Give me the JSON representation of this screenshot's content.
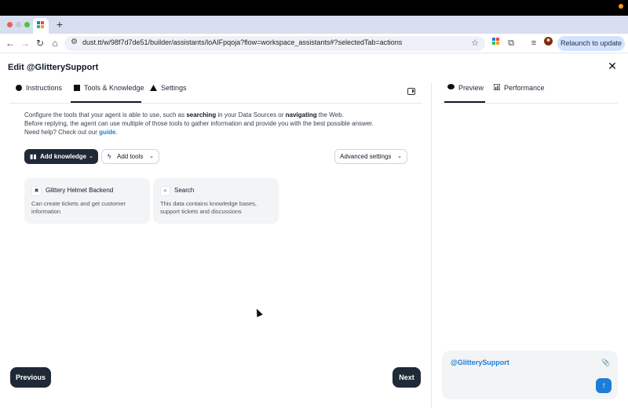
{
  "browser": {
    "url": "dust.tt/w/98f7d7de51/builder/assistants/loAIFpqoja?flow=workspace_assistants#?selectedTab=actions",
    "relaunch_label": "Relaunch to update",
    "new_tab_glyph": "+",
    "icons": [
      "back-icon",
      "forward-icon",
      "reload-icon",
      "home-icon",
      "site-settings-icon",
      "bookmark-star-icon",
      "extensions-icon",
      "media-icon",
      "profile-icon",
      "menu-icon"
    ]
  },
  "header": {
    "title": "Edit @GlitterySupport",
    "close_glyph": "✕"
  },
  "tabs": [
    {
      "label": "Instructions",
      "icon": "circle-icon",
      "active": false
    },
    {
      "label": "Tools & Knowledge",
      "icon": "square-icon",
      "active": true
    },
    {
      "label": "Settings",
      "icon": "triangle-icon",
      "active": false
    }
  ],
  "description": {
    "line1_prefix": "Configure the tools that your agent is able to use, such as ",
    "line1_bold1": "searching",
    "line1_mid": " in your Data Sources or ",
    "line1_bold2": "navigating",
    "line1_suffix": " the Web.",
    "line2": "Before replying, the agent can use multiple of those tools to gather information and provide you with the best possible answer.",
    "line3_prefix": "Need help? Check out our ",
    "line3_link": "guide",
    "line3_suffix": "."
  },
  "buttons": {
    "add_knowledge": "Add knowledge",
    "add_tools": "Add tools",
    "advanced_settings": "Advanced settings",
    "previous": "Previous",
    "next": "Next"
  },
  "cards": [
    {
      "title": "Glittery Helmet Backend",
      "text": "Can create tickets and get customer information",
      "icon": "tool-icon"
    },
    {
      "title": "Search",
      "text": "This data contains knowledge bases, support tickets and discussions",
      "icon": "search-icon"
    }
  ],
  "right_tabs": [
    {
      "label": "Preview",
      "icon": "chat-bubble-icon",
      "active": true
    },
    {
      "label": "Performance",
      "icon": "bar-chart-icon",
      "active": false
    }
  ],
  "chat": {
    "mention": "@GlitterySupport"
  },
  "colors": {
    "primary_dark": "#1f2937",
    "accent_blue": "#1c7ed6",
    "card_bg": "#f3f4f6"
  }
}
